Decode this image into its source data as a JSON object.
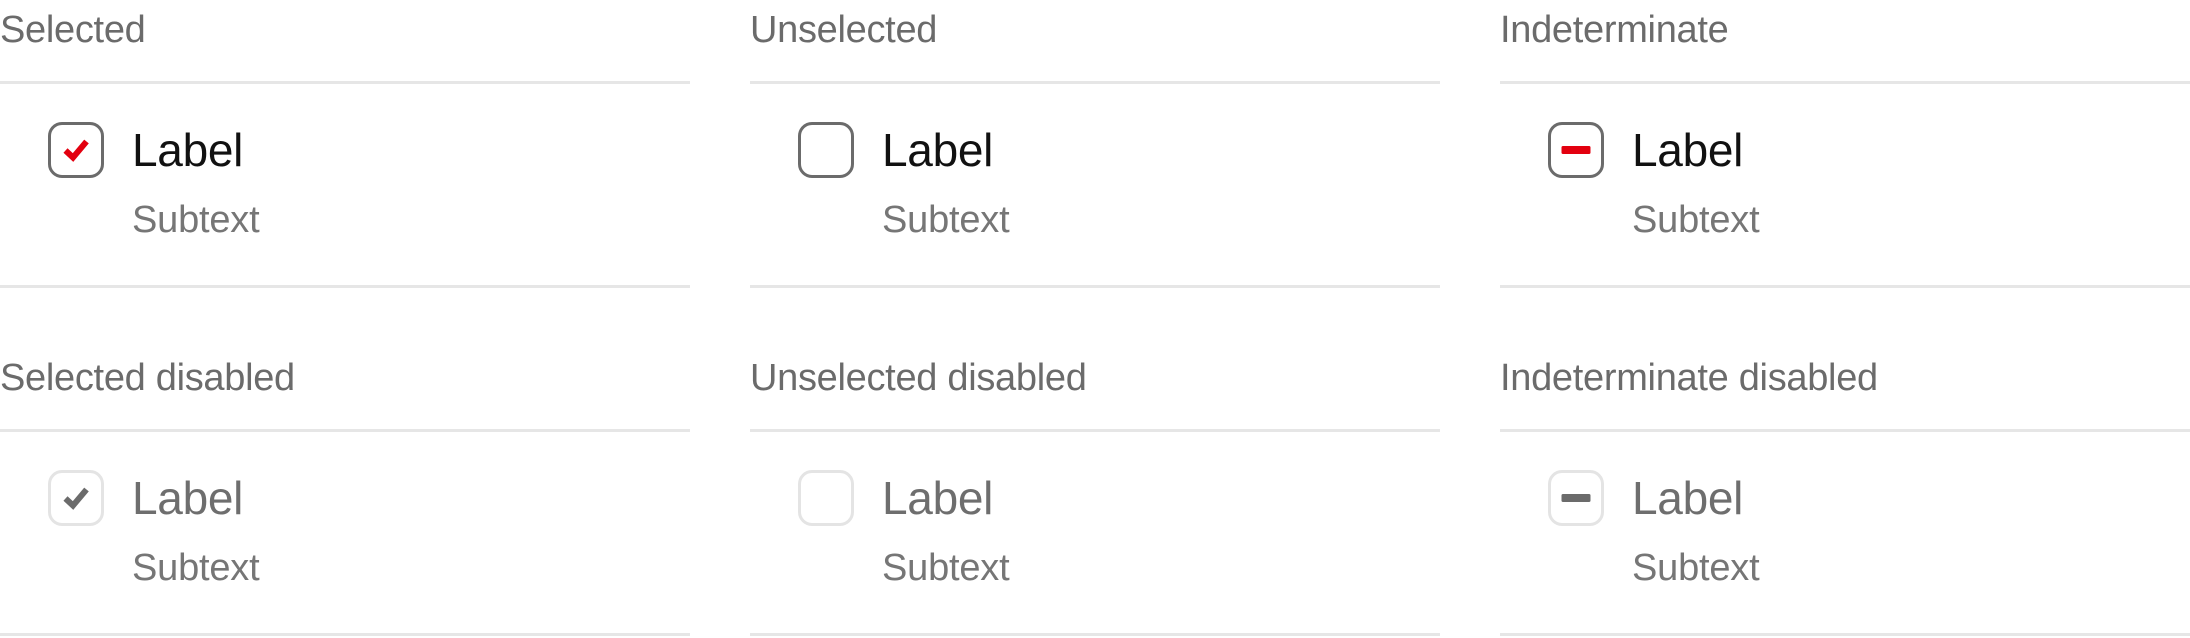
{
  "colors": {
    "accent": "#e3000f",
    "border": "#6b6b6b",
    "disabled_border": "#e4e4e4",
    "disabled_mark": "#6b6b6b",
    "divider": "#e6e6e6",
    "label": "#111111",
    "muted_text": "#767676"
  },
  "states": [
    {
      "title": "Selected",
      "label": "Label",
      "subtext": "Subtext",
      "state": "checked",
      "disabled": false
    },
    {
      "title": "Unselected",
      "label": "Label",
      "subtext": "Subtext",
      "state": "unchecked",
      "disabled": false
    },
    {
      "title": "Indeterminate",
      "label": "Label",
      "subtext": "Subtext",
      "state": "indeterminate",
      "disabled": false
    },
    {
      "title": "Selected disabled",
      "label": "Label",
      "subtext": "Subtext",
      "state": "checked",
      "disabled": true
    },
    {
      "title": "Unselected disabled",
      "label": "Label",
      "subtext": "Subtext",
      "state": "unchecked",
      "disabled": true
    },
    {
      "title": "Indeterminate disabled",
      "label": "Label",
      "subtext": "Subtext",
      "state": "indeterminate",
      "disabled": true
    }
  ]
}
